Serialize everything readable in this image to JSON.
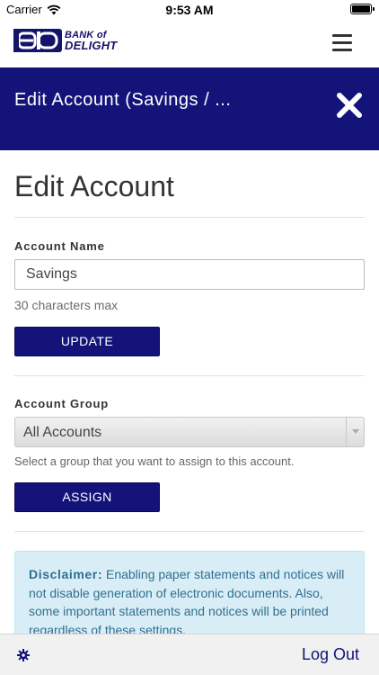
{
  "status_bar": {
    "carrier": "Carrier",
    "time": "9:53 AM"
  },
  "header": {
    "logo_line1": "BANK of",
    "logo_line2": "DELIGHT"
  },
  "banner": {
    "title": "Edit Account (Savings / ..."
  },
  "page": {
    "title": "Edit Account"
  },
  "account_name": {
    "label": "Account Name",
    "value": "Savings",
    "hint": "30 characters max",
    "button": "UPDATE"
  },
  "account_group": {
    "label": "Account Group",
    "selected": "All Accounts",
    "hint": "Select a group that you want to assign to this account.",
    "button": "ASSIGN"
  },
  "disclaimer": {
    "label": "Disclaimer:",
    "text": "Enabling paper statements and notices will not disable generation of electronic documents. Also, some important statements and notices will be printed regardless of these settings."
  },
  "footer": {
    "logout": "Log Out"
  },
  "colors": {
    "brand": "#13137a",
    "info_bg": "#d9edf7",
    "info_text": "#31708f"
  }
}
